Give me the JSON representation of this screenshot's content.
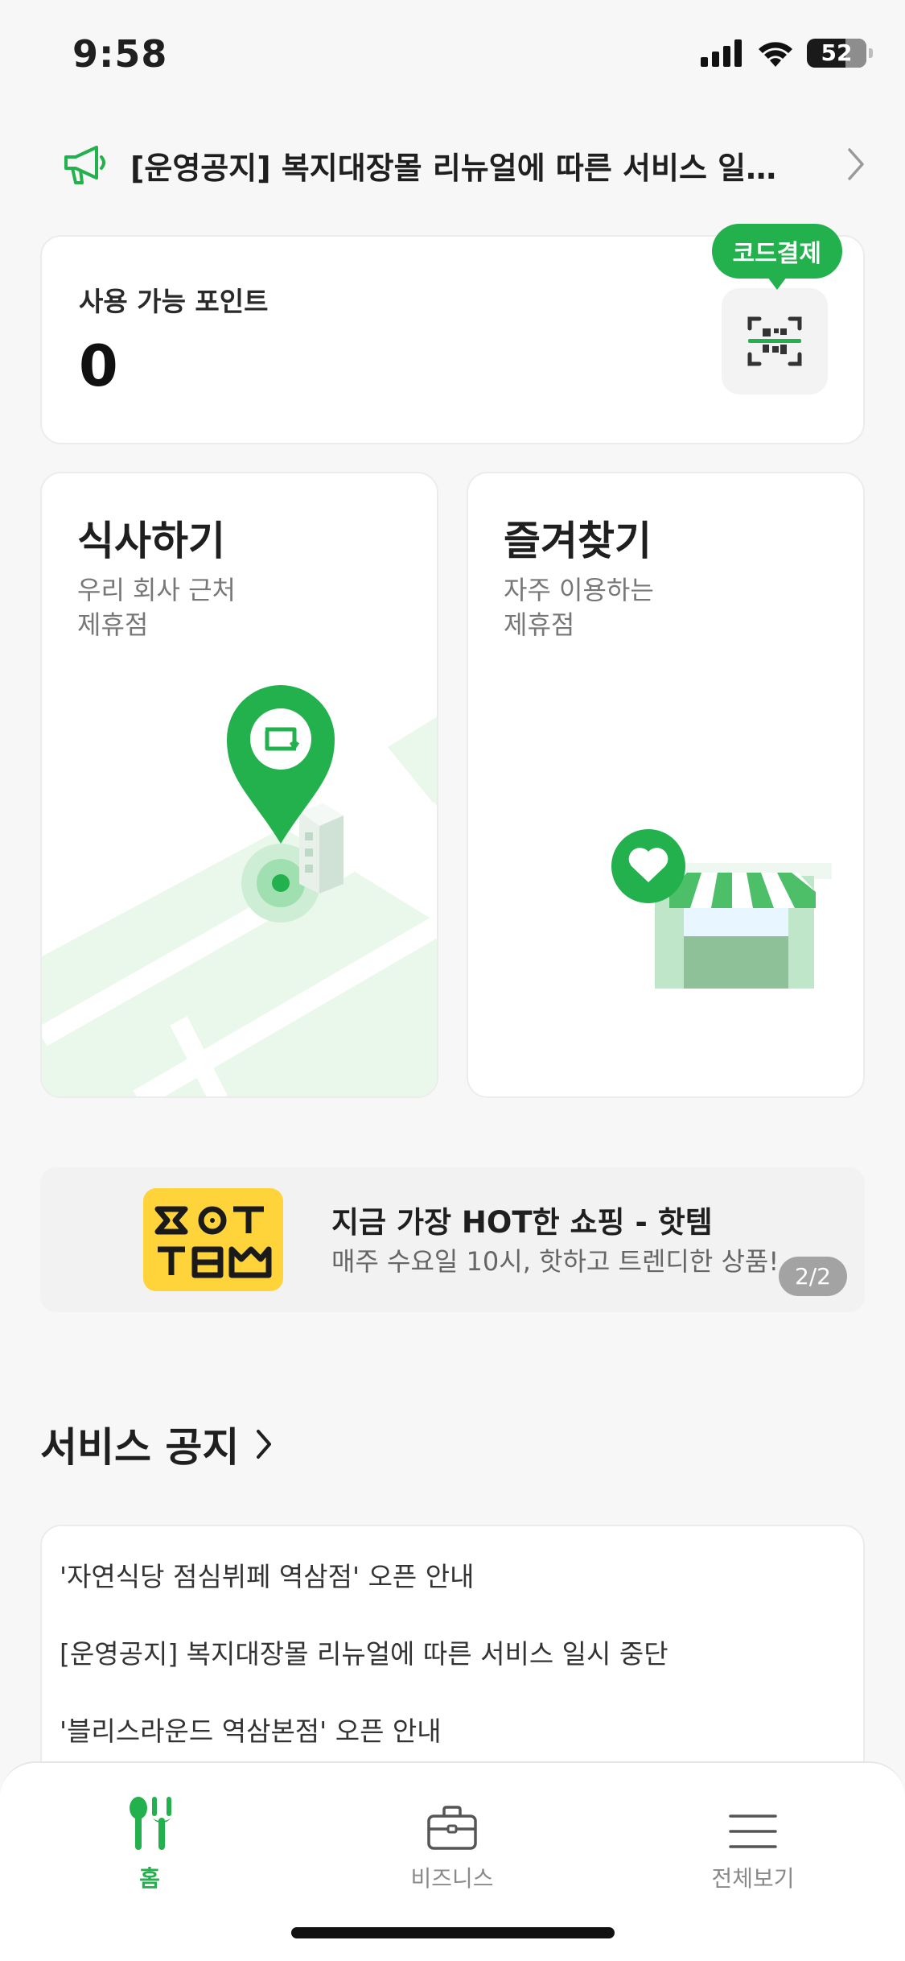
{
  "status_bar": {
    "time": "9:58",
    "battery": "52"
  },
  "announcement": {
    "text": "[운영공지] 복지대장몰 리뉴얼에 따른 서비스 일시 중단"
  },
  "points": {
    "label": "사용 가능 포인트",
    "value": "0",
    "code_pay_label": "코드결제"
  },
  "cards": [
    {
      "title": "식사하기",
      "subtitle_line1": "우리 회사 근처",
      "subtitle_line2": "제휴점"
    },
    {
      "title": "즐겨찾기",
      "subtitle_line1": "자주 이용하는",
      "subtitle_line2": "제휴점"
    }
  ],
  "banner": {
    "logo_text_top": "HOT",
    "logo_text_bottom": "TEM",
    "title": "지금 가장 HOT한 쇼핑 - 핫템",
    "subtitle": "매주 수요일 10시, 핫하고 트렌디한 상품!",
    "page": "2/2"
  },
  "service_notice": {
    "title": "서비스 공지",
    "items": [
      "'자연식당 점심뷔페 역삼점' 오픈 안내",
      "[운영공지] 복지대장몰 리뉴얼에 따른 서비스 일시 중단",
      "'블리스라운드 역삼본점' 오픈 안내"
    ]
  },
  "tab_bar": {
    "tabs": [
      {
        "label": "홈",
        "icon": "fork-spoon-icon",
        "active": true
      },
      {
        "label": "비즈니스",
        "icon": "briefcase-icon",
        "active": false
      },
      {
        "label": "전체보기",
        "icon": "menu-icon",
        "active": false
      }
    ]
  },
  "colors": {
    "accent": "#22b14c",
    "background": "#f7f7f7",
    "banner_logo": "#ffd43b"
  }
}
